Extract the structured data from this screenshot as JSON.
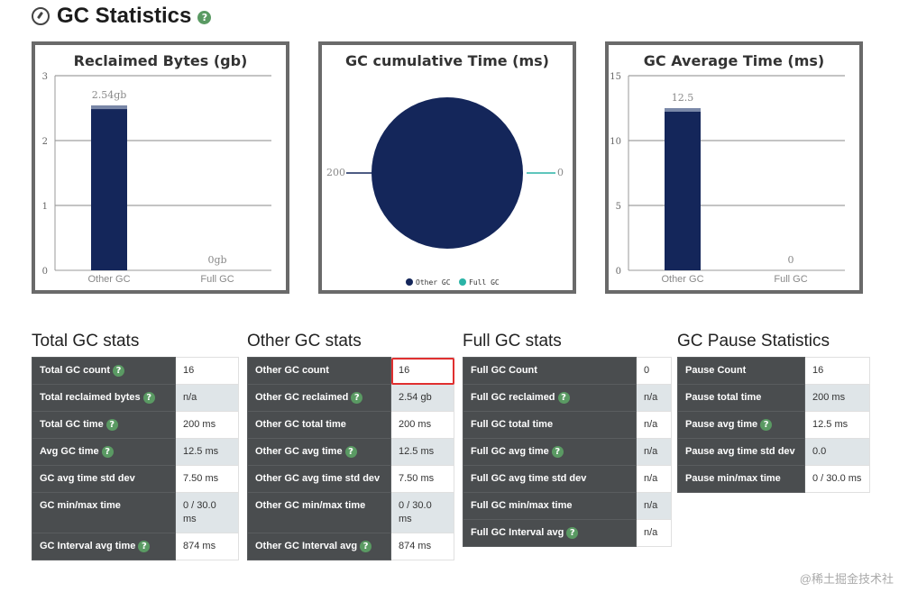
{
  "page": {
    "title": "GC Statistics"
  },
  "colors": {
    "other_gc": "#14265a",
    "full_gc": "#2ab3a6",
    "header_bg": "#4a4d4f"
  },
  "chart_data": [
    {
      "type": "bar",
      "title": "Reclaimed Bytes (gb)",
      "categories": [
        "Other GC",
        "Full GC"
      ],
      "values": [
        2.54,
        0
      ],
      "data_labels": [
        "2.54gb",
        "0gb"
      ],
      "ylim": [
        0,
        3
      ],
      "yticks": [
        "0",
        "1",
        "2",
        "3"
      ],
      "grid": true
    },
    {
      "type": "pie",
      "title": "GC cumulative Time (ms)",
      "categories": [
        "Other GC",
        "Full GC"
      ],
      "values": [
        200,
        0
      ],
      "data_labels": [
        "200",
        "0"
      ],
      "legend": [
        "Other GC",
        "Full GC"
      ],
      "legend_position": "bottom"
    },
    {
      "type": "bar",
      "title": "GC Average Time (ms)",
      "categories": [
        "Other GC",
        "Full GC"
      ],
      "values": [
        12.5,
        0
      ],
      "data_labels": [
        "12.5",
        "0"
      ],
      "ylim": [
        0,
        15
      ],
      "yticks": [
        "0",
        "5",
        "10",
        "15"
      ],
      "grid": true
    }
  ],
  "total": {
    "heading": "Total GC stats",
    "rows": [
      {
        "label": "Total GC count",
        "value": "16",
        "help": true
      },
      {
        "label": "Total reclaimed bytes",
        "value": "n/a",
        "help": true
      },
      {
        "label": "Total GC time",
        "value": "200 ms",
        "help": true
      },
      {
        "label": "Avg GC time",
        "value": "12.5 ms",
        "help": true
      },
      {
        "label": "GC avg time std dev",
        "value": "7.50 ms",
        "help": false
      },
      {
        "label": "GC min/max time",
        "value": "0 / 30.0 ms",
        "help": false
      },
      {
        "label": "GC Interval avg time",
        "value": "874 ms",
        "help": true
      }
    ]
  },
  "other": {
    "heading": "Other GC stats",
    "rows": [
      {
        "label": "Other GC count",
        "value": "16",
        "help": false
      },
      {
        "label": "Other GC reclaimed",
        "value": "2.54 gb",
        "help": true
      },
      {
        "label": "Other GC total time",
        "value": "200 ms",
        "help": false
      },
      {
        "label": "Other GC avg time",
        "value": "12.5 ms",
        "help": true
      },
      {
        "label": "Other GC avg time std dev",
        "value": "7.50 ms",
        "help": false
      },
      {
        "label": "Other GC min/max time",
        "value": "0 / 30.0 ms",
        "help": false
      },
      {
        "label": "Other GC Interval avg",
        "value": "874 ms",
        "help": true
      }
    ]
  },
  "full": {
    "heading": "Full GC stats",
    "rows": [
      {
        "label": "Full GC Count",
        "value": "0",
        "help": false
      },
      {
        "label": "Full GC reclaimed",
        "value": "n/a",
        "help": true
      },
      {
        "label": "Full GC total time",
        "value": "n/a",
        "help": false
      },
      {
        "label": "Full GC avg time",
        "value": "n/a",
        "help": true
      },
      {
        "label": "Full GC avg time std dev",
        "value": "n/a",
        "help": false
      },
      {
        "label": "Full GC min/max time",
        "value": "n/a",
        "help": false
      },
      {
        "label": "Full GC Interval avg",
        "value": "n/a",
        "help": true
      }
    ]
  },
  "pause": {
    "heading": "GC Pause Statistics",
    "rows": [
      {
        "label": "Pause Count",
        "value": "16",
        "help": false
      },
      {
        "label": "Pause total time",
        "value": "200 ms",
        "help": false
      },
      {
        "label": "Pause avg time",
        "value": "12.5 ms",
        "help": true
      },
      {
        "label": "Pause avg time std dev",
        "value": "0.0",
        "help": false
      },
      {
        "label": "Pause min/max time",
        "value": "0 / 30.0 ms",
        "help": false
      }
    ]
  },
  "watermark": "@稀土掘金技术社"
}
